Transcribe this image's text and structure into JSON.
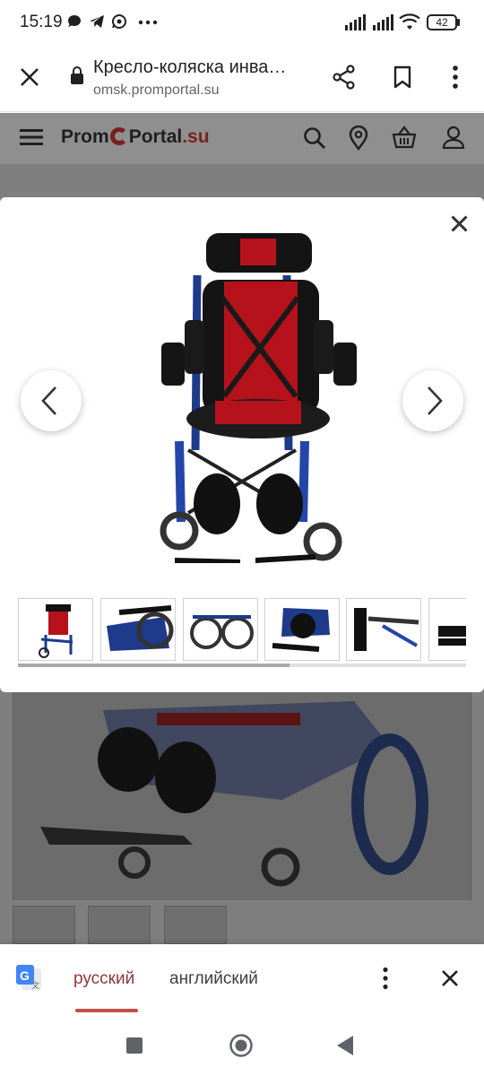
{
  "status_bar": {
    "time": "15:19",
    "battery": "42",
    "icons": [
      "chat-icon",
      "telegram-icon",
      "whatsapp-icon",
      "more-dots-icon",
      "signal-icon",
      "signal-icon",
      "wifi-icon",
      "battery-icon"
    ]
  },
  "browser": {
    "page_title": "Кресло-коляска инва…",
    "url": "omsk.promportal.su",
    "icons": [
      "close-icon",
      "lock-icon",
      "share-icon",
      "bookmark-icon",
      "overflow-menu-icon"
    ]
  },
  "site_header": {
    "logo_prom": "Prom",
    "logo_portal": "Portal",
    "logo_su": ".su",
    "icons": [
      "menu-icon",
      "search-icon",
      "location-icon",
      "basket-icon",
      "user-icon"
    ]
  },
  "gallery": {
    "close_icon": "close-icon",
    "prev_icon": "chevron-left-icon",
    "next_icon": "chevron-right-icon",
    "thumbnail_count": 6
  },
  "translate_bar": {
    "lang_source": "русский",
    "lang_target": "английский",
    "icons": [
      "google-translate-icon",
      "more-vert-icon",
      "close-icon"
    ]
  },
  "system_nav": {
    "icons": [
      "recents-icon",
      "home-icon",
      "back-icon"
    ]
  },
  "colors": {
    "brand_red": "#d32f2f",
    "accent_red_underline": "#c0504d",
    "header_gray": "#8f8f8f",
    "overlay_gray": "#7f7f7f"
  }
}
